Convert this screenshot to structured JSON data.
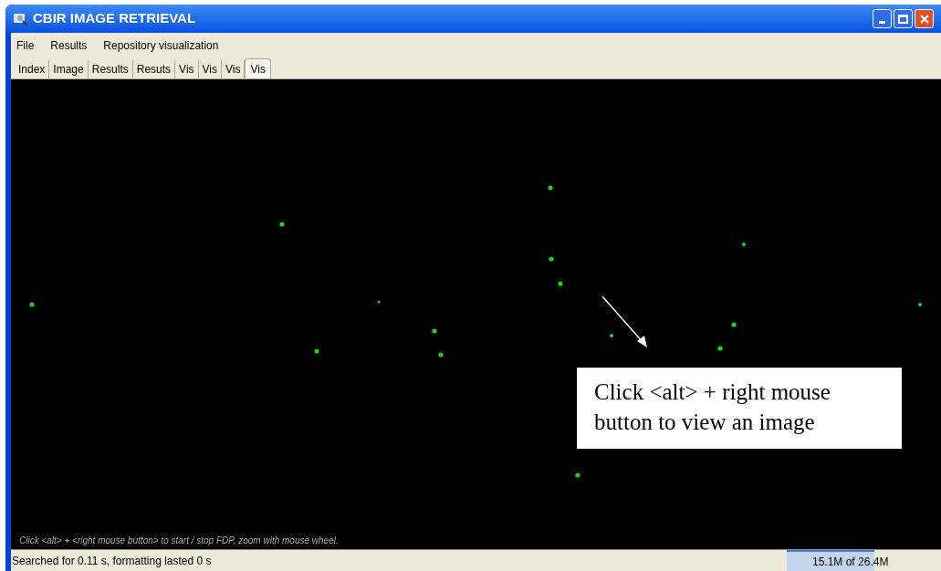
{
  "window": {
    "title": "CBIR IMAGE RETRIEVAL"
  },
  "menu": [
    "File",
    "Results",
    "Repository visualization"
  ],
  "tabs": [
    {
      "label": "Index",
      "selected": false
    },
    {
      "label": "Image",
      "selected": false
    },
    {
      "label": "Results",
      "selected": false
    },
    {
      "label": "Resuts",
      "selected": false
    },
    {
      "label": "Vis",
      "selected": false
    },
    {
      "label": "Vis",
      "selected": false
    },
    {
      "label": "Vis",
      "selected": false
    },
    {
      "label": "Vis",
      "selected": true
    }
  ],
  "canvas": {
    "hint": "Click <alt> + <right mouse button> to start / stop FDP, zoom with mouse wheel.",
    "callout": "Click <alt> + right mouse button to view an image"
  },
  "status_bar": {
    "message": "Searched for 0.11 s, formatting lasted 0 s",
    "memory": {
      "reading": "15.1M of 26.4M",
      "level": 0.57
    }
  }
}
